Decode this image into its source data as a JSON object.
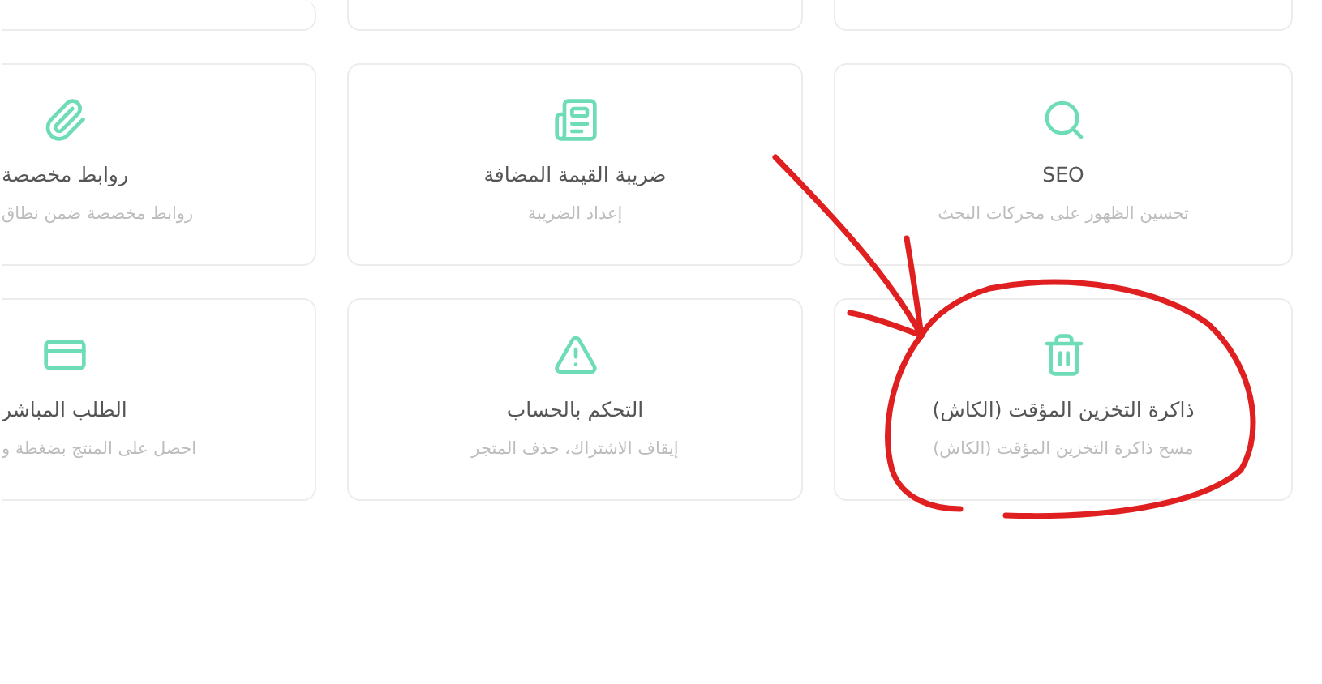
{
  "cards": [
    {
      "title": "SEO",
      "subtitle": "تحسين الظهور على محركات البحث"
    },
    {
      "title": "ضريبة القيمة المضافة",
      "subtitle": "إعداد الضريبة"
    },
    {
      "title": "روابط مخصصة",
      "subtitle": "روابط مخصصة ضمن نطاق"
    },
    {
      "title": "ذاكرة التخزين المؤقت (الكاش)",
      "subtitle": "مسح ذاكرة التخزين المؤقت (الكاش)"
    },
    {
      "title": "التحكم بالحساب",
      "subtitle": "إيقاف الاشتراك، حذف المتجر"
    },
    {
      "title": "الطلب المباشر",
      "subtitle": "احصل على المنتج بضغطة و"
    }
  ]
}
